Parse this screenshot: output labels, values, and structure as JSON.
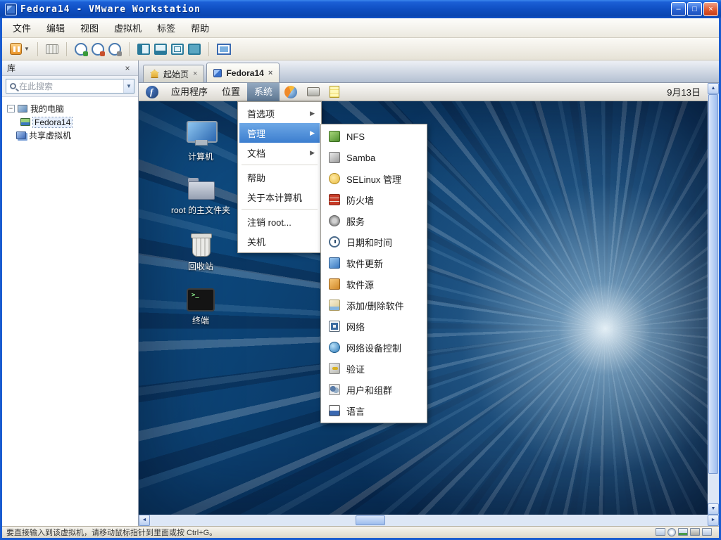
{
  "window": {
    "title": "Fedora14 - VMware Workstation"
  },
  "window_controls": {
    "minimize": "–",
    "maximize": "□",
    "close": "×"
  },
  "menubar": {
    "items": [
      "文件",
      "编辑",
      "视图",
      "虚拟机",
      "标签",
      "帮助"
    ]
  },
  "sidebar": {
    "title": "库",
    "close": "×",
    "search": {
      "placeholder": "在此搜索"
    },
    "tree": {
      "my_computer": "我的电脑",
      "vm": "Fedora14",
      "shared": "共享虚拟机"
    }
  },
  "tabs": [
    {
      "label": "起始页",
      "close": "×"
    },
    {
      "label": "Fedora14",
      "close": "×"
    }
  ],
  "vm": {
    "panel": {
      "menus": [
        "应用程序",
        "位置",
        "系统"
      ],
      "date": "9月13日"
    },
    "system_menu": [
      "首选项",
      "管理",
      "文档",
      "帮助",
      "关于本计算机",
      "注销 root...",
      "关机"
    ],
    "admin_submenu": [
      "NFS",
      "Samba",
      "SELinux 管理",
      "防火墙",
      "服务",
      "日期和时间",
      "软件更新",
      "软件源",
      "添加/删除软件",
      "网络",
      "网络设备控制",
      "验证",
      "用户和组群",
      "语言"
    ],
    "desktop_icons": [
      "计算机",
      "root 的主文件夹",
      "回收站",
      "终端"
    ]
  },
  "statusbar": {
    "hint": "要直接输入到该虚拟机，请移动鼠标指针到里面或按 Ctrl+G。"
  },
  "glyphs": {
    "submenu_arrow": "▶",
    "dropdown_arrow": "▼",
    "up": "▲",
    "down": "▼",
    "left": "◄",
    "right": "►",
    "expander_open": "−"
  }
}
